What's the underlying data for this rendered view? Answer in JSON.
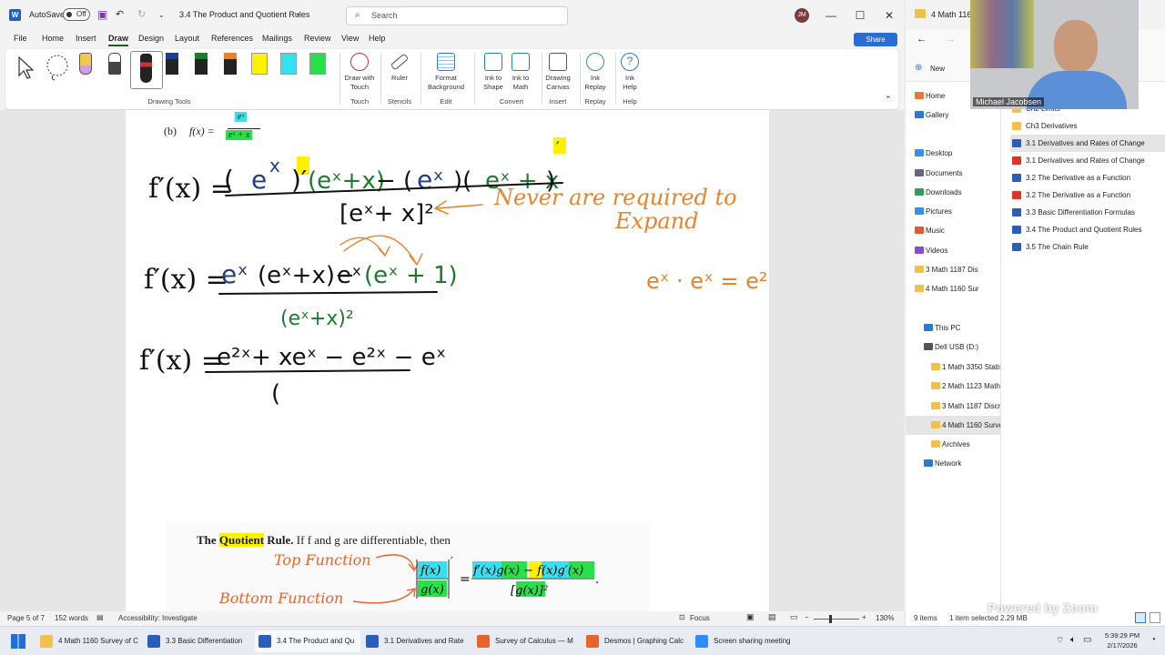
{
  "word": {
    "autosave_label": "AutoSave",
    "autosave_state": "Off",
    "doc_title": "3.4 The Product and Quotient Rules",
    "search_placeholder": "Search",
    "user_initials": "JM",
    "menu": [
      "File",
      "Home",
      "Insert",
      "Draw",
      "Design",
      "Layout",
      "References",
      "Mailings",
      "Review",
      "View",
      "Help"
    ],
    "active_menu": "Draw",
    "share_label": "Share",
    "ribbon": {
      "drawing_tools_label": "Drawing Tools",
      "buttons": [
        {
          "label1": "Draw with",
          "label2": "Touch",
          "group": "Touch"
        },
        {
          "label1": "Ruler",
          "label2": "",
          "group": "Stencils"
        },
        {
          "label1": "Format",
          "label2": "Background",
          "group": "Edit"
        },
        {
          "label1": "Ink to",
          "label2": "Shape",
          "group": "Convert"
        },
        {
          "label1": "Ink to",
          "label2": "Math",
          "group": ""
        },
        {
          "label1": "Drawing",
          "label2": "Canvas",
          "group": "Insert"
        },
        {
          "label1": "Ink",
          "label2": "Replay",
          "group": "Replay"
        },
        {
          "label1": "Ink",
          "label2": "Help",
          "group": "Help"
        }
      ]
    },
    "document": {
      "part_label": "(b)",
      "fx": "f(x) =",
      "numerator": "eˣ",
      "denominator": "eˣ + x",
      "ink_note1": "Never are required to",
      "ink_note2": "Expand",
      "side_identity": "eˣ · eˣ = e²ˣ",
      "quotient_rule_pre": "The",
      "quotient_rule_word": "Quotient",
      "quotient_rule_post": "Rule.",
      "quotient_rule_text": "If f and g are differentiable, then",
      "top_function": "Top Function",
      "bottom_function": "Bottom Function"
    },
    "status": {
      "page": "Page 5 of 7",
      "words": "152 words",
      "accessibility": "Accessibility: Investigate",
      "focus": "Focus",
      "zoom": "130%"
    }
  },
  "explorer": {
    "title": "4 Math 1160",
    "new_label": "New",
    "nav": [
      {
        "label": "Home",
        "icon": "home-icon",
        "color": "#e07b39"
      },
      {
        "label": "Gallery",
        "icon": "gallery-icon",
        "color": "#2b7bd6"
      },
      {
        "label": "Desktop",
        "icon": "desktop-icon",
        "color": "#3a8ee6"
      },
      {
        "label": "Documents",
        "icon": "documents-icon",
        "color": "#5f6b7a"
      },
      {
        "label": "Downloads",
        "icon": "downloads-icon",
        "color": "#2e9e5b"
      },
      {
        "label": "Pictures",
        "icon": "pictures-icon",
        "color": "#3a8ee6"
      },
      {
        "label": "Music",
        "icon": "music-icon",
        "color": "#e05a3a"
      },
      {
        "label": "Videos",
        "icon": "videos-icon",
        "color": "#8a4ad6"
      },
      {
        "label": "3 Math 1187 Dis",
        "icon": "folder-icon",
        "color": "#f0c24b"
      },
      {
        "label": "4 Math 1160 Sur",
        "icon": "folder-icon",
        "color": "#f0c24b"
      },
      {
        "label": "This PC",
        "icon": "pc-icon",
        "color": "#2b7bd6"
      },
      {
        "label": "Dell USB (D:)",
        "icon": "drive-icon",
        "color": "#555555"
      },
      {
        "label": "1 Math 3350 Statis",
        "icon": "folder-icon",
        "color": "#f0c24b"
      },
      {
        "label": "2 Math 1123 Math",
        "icon": "folder-icon",
        "color": "#f0c24b"
      },
      {
        "label": "3 Math 1187 Discr",
        "icon": "folder-icon",
        "color": "#f0c24b"
      },
      {
        "label": "4 Math 1160 Surve",
        "icon": "folder-icon",
        "color": "#f0c24b"
      },
      {
        "label": "Archives",
        "icon": "folder-icon",
        "color": "#f0c24b"
      },
      {
        "label": "Network",
        "icon": "network-icon",
        "color": "#2b7bd6"
      }
    ],
    "files": [
      {
        "label": "Ch2 Limits",
        "type": "folder"
      },
      {
        "label": "Ch3 Derivatives",
        "type": "folder"
      },
      {
        "label": "3.1 Derivatives and Rates of Change",
        "type": "word"
      },
      {
        "label": "3.1 Derivatives and Rates of Change",
        "type": "pdf"
      },
      {
        "label": "3.2 The Derivative as a Function",
        "type": "word"
      },
      {
        "label": "3.2 The Derivative as a Function",
        "type": "pdf"
      },
      {
        "label": "3.3 Basic Differentiation Formulas",
        "type": "word"
      },
      {
        "label": "3.4 The Product and Quotient Rules",
        "type": "word"
      },
      {
        "label": "3.5 The Chain Rule",
        "type": "word"
      }
    ],
    "status_items": "9 items",
    "status_selected": "1 item selected",
    "status_size": "2.29 MB"
  },
  "webcam": {
    "name": "Michael Jacobsen"
  },
  "zoom_brand": "Powered by Zoom",
  "taskbar": {
    "tasks": [
      {
        "label": "4 Math 1160 Survey of C",
        "color": "#f0c24b"
      },
      {
        "label": "3.3 Basic Differentiation",
        "color": "#2b5eb8"
      },
      {
        "label": "3.4 The Product and Qu",
        "color": "#2b5eb8"
      },
      {
        "label": "3.1 Derivatives and Rate",
        "color": "#2b5eb8"
      },
      {
        "label": "Survey of Calculus — M",
        "color": "#e8632b"
      },
      {
        "label": "Desmos | Graphing Calc",
        "color": "#e8632b"
      },
      {
        "label": "Screen sharing meeting",
        "color": "#2d8cff"
      }
    ],
    "time": "5:39:29 PM",
    "date": "2/17/2026"
  }
}
